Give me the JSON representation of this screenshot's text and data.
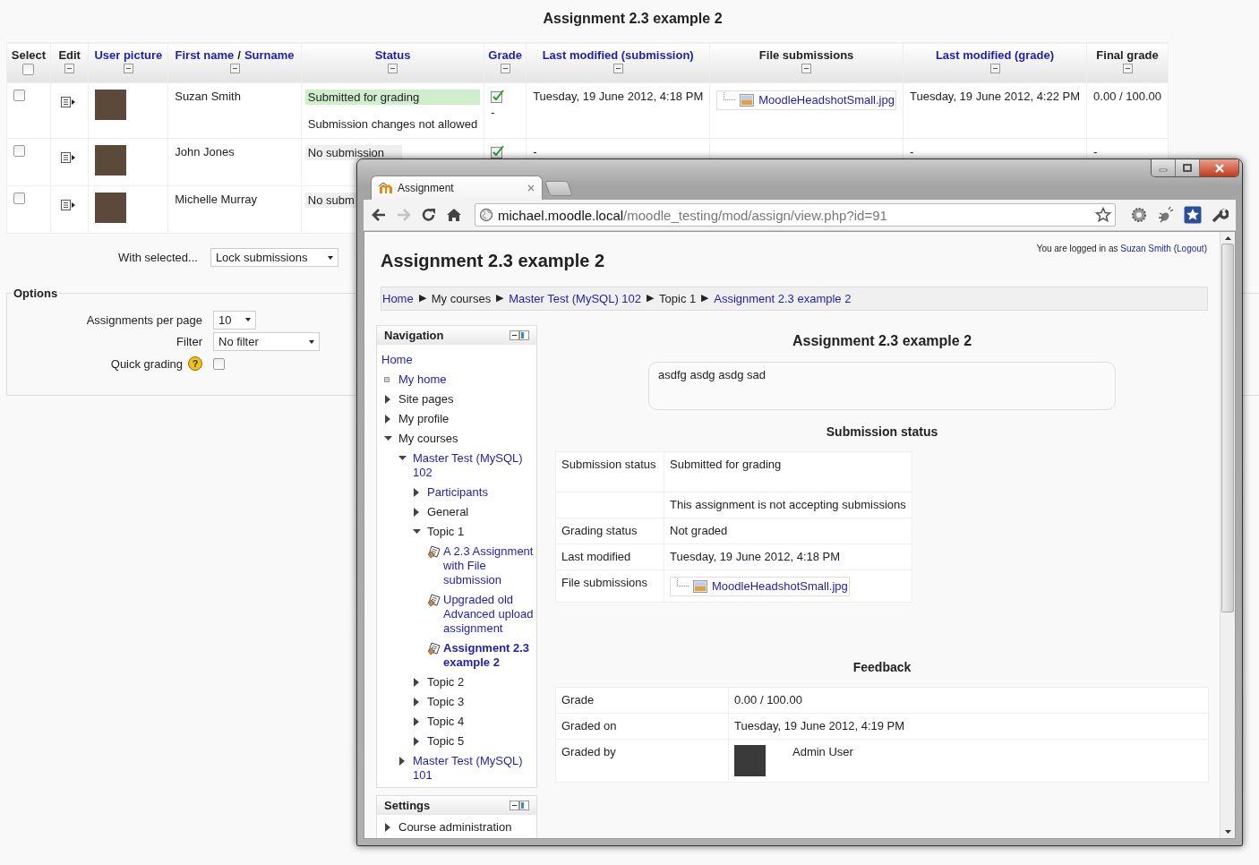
{
  "page_title": "Assignment 2.3 example 2",
  "grading_table": {
    "select_all_checked": false,
    "columns": [
      {
        "kind": "select",
        "parts": [
          {
            "text": "Select",
            "link": false
          }
        ]
      },
      {
        "kind": "field",
        "parts": [
          {
            "text": "Edit",
            "link": false
          }
        ]
      },
      {
        "kind": "field",
        "parts": [
          {
            "text": "User picture",
            "link": true
          }
        ]
      },
      {
        "kind": "field",
        "parts": [
          {
            "text": "First name",
            "link": true
          },
          {
            "text": "/",
            "link": false
          },
          {
            "text": "Surname",
            "link": true
          }
        ]
      },
      {
        "kind": "field",
        "parts": [
          {
            "text": "Status",
            "link": true
          }
        ]
      },
      {
        "kind": "field",
        "parts": [
          {
            "text": "Grade",
            "link": true
          }
        ]
      },
      {
        "kind": "field",
        "parts": [
          {
            "text": "Last modified (submission)",
            "link": true
          }
        ]
      },
      {
        "kind": "field",
        "parts": [
          {
            "text": "File submissions",
            "link": false
          }
        ]
      },
      {
        "kind": "field",
        "parts": [
          {
            "text": "Last modified (grade)",
            "link": true
          }
        ]
      },
      {
        "kind": "field",
        "parts": [
          {
            "text": "Final grade",
            "link": false
          }
        ]
      }
    ],
    "rows": [
      {
        "checked": false,
        "name": "Suzan Smith",
        "status": [
          {
            "text": "Submitted for grading",
            "kind": "submitted"
          },
          {
            "text": "Submission changes not allowed",
            "kind": "note"
          }
        ],
        "grade_icon": true,
        "grade": "-",
        "last_modified": "Tuesday, 19 June 2012, 4:18 PM",
        "file": "MoodleHeadshotSmall.jpg",
        "last_modified_grade": "Tuesday, 19 June 2012, 4:22 PM",
        "final_grade": "0.00 / 100.00"
      },
      {
        "checked": false,
        "name": "John Jones",
        "status": [
          {
            "text": "No submission",
            "kind": "none"
          }
        ],
        "grade_icon": true,
        "last_modified": "-",
        "last_modified_grade": "-",
        "final_grade": "-"
      },
      {
        "checked": false,
        "name": "Michelle Murray",
        "status": [
          {
            "text": "No subm",
            "kind": "none"
          }
        ],
        "grade_icon": false
      }
    ]
  },
  "bulk": {
    "label": "With selected...",
    "value": "Lock submissions"
  },
  "options": {
    "legend": "Options",
    "fields": [
      {
        "label": "Assignments per page",
        "kind": "select",
        "value": "10"
      },
      {
        "label": "Filter",
        "kind": "select",
        "value": "No filter"
      },
      {
        "label": "Quick grading",
        "kind": "checkbox",
        "checked": false,
        "help": "?"
      }
    ]
  },
  "browser": {
    "tabs": [
      {
        "title": "Assignment",
        "selected": true
      }
    ],
    "url": {
      "host": "michael.moodle.local",
      "path": "/moodle_testing/mod/assign/view.php?id=91"
    },
    "page": {
      "heading": "Assignment 2.3 example 2",
      "login": [
        {
          "text": "You are logged in as",
          "link": false
        },
        {
          "text": "Suzan Smith",
          "link": true
        },
        {
          "text": "(",
          "link": false
        },
        {
          "text": "Logout",
          "link": true
        },
        {
          "text": ")",
          "link": false
        }
      ],
      "breadcrumb": {
        "separator": "▶",
        "items": [
          {
            "text": "Home",
            "link": true
          },
          {
            "text": "My courses",
            "link": false
          },
          {
            "text": "Master Test (MySQL) 102",
            "link": true
          },
          {
            "text": "Topic 1",
            "link": false
          },
          {
            "text": "Assignment 2.3 example 2",
            "link": true
          }
        ]
      },
      "navigation": {
        "title": "Navigation",
        "items": [
          {
            "label": "Home",
            "kind": "root",
            "link": true
          },
          {
            "label": "My home",
            "kind": "leaf",
            "link": true
          },
          {
            "label": "Site pages",
            "kind": "branch",
            "link": false,
            "expanded": false
          },
          {
            "label": "My profile",
            "kind": "branch",
            "link": false,
            "expanded": false
          },
          {
            "label": "My courses",
            "kind": "branch",
            "link": false,
            "expanded": true,
            "children": [
              {
                "label": "Master Test (MySQL) 102",
                "kind": "branch",
                "link": true,
                "expanded": true,
                "children": [
                  {
                    "label": "Participants",
                    "kind": "branch",
                    "link": true,
                    "expanded": false
                  },
                  {
                    "label": "General",
                    "kind": "branch",
                    "link": false,
                    "expanded": false
                  },
                  {
                    "label": "Topic 1",
                    "kind": "branch",
                    "link": false,
                    "expanded": true,
                    "children": [
                      {
                        "label": "A 2.3 Assignment with File submission",
                        "kind": "activity",
                        "link": true,
                        "current": false
                      },
                      {
                        "label": "Upgraded old Advanced upload assignment",
                        "kind": "activity",
                        "link": true,
                        "current": false
                      },
                      {
                        "label": "Assignment 2.3 example 2",
                        "kind": "activity",
                        "link": true,
                        "current": true
                      }
                    ]
                  },
                  {
                    "label": "Topic 2",
                    "kind": "branch",
                    "link": false,
                    "expanded": false
                  },
                  {
                    "label": "Topic 3",
                    "kind": "branch",
                    "link": false,
                    "expanded": false
                  },
                  {
                    "label": "Topic 4",
                    "kind": "branch",
                    "link": false,
                    "expanded": false
                  },
                  {
                    "label": "Topic 5",
                    "kind": "branch",
                    "link": false,
                    "expanded": false
                  }
                ]
              },
              {
                "label": "Master Test (MySQL) 101",
                "kind": "branch",
                "link": true,
                "expanded": false
              }
            ]
          }
        ]
      },
      "settings": {
        "title": "Settings",
        "items": [
          {
            "label": "Course administration",
            "kind": "branch",
            "link": false,
            "expanded": false
          }
        ]
      },
      "main": {
        "heading": "Assignment 2.3 example 2",
        "intro": "asdfg asdg asdg sad",
        "submission_title": "Submission status",
        "submission_rows": [
          {
            "label": "Submission status",
            "value": "Submitted for grading",
            "kind": "text"
          },
          {
            "value": "This assignment is not accepting submissions",
            "kind": "text"
          },
          {
            "label": "Grading status",
            "value": "Not graded",
            "kind": "text"
          },
          {
            "label": "Last modified",
            "value": "Tuesday, 19 June 2012, 4:18 PM",
            "kind": "text"
          },
          {
            "label": "File submissions",
            "value": "MoodleHeadshotSmall.jpg",
            "kind": "file"
          }
        ],
        "feedback_title": "Feedback",
        "feedback_rows": [
          {
            "label": "Grade",
            "value": "0.00 / 100.00",
            "kind": "text"
          },
          {
            "label": "Graded on",
            "value": "Tuesday, 19 June 2012, 4:19 PM",
            "kind": "text"
          },
          {
            "label": "Graded by",
            "value": "Admin User",
            "kind": "user"
          }
        ]
      }
    }
  }
}
